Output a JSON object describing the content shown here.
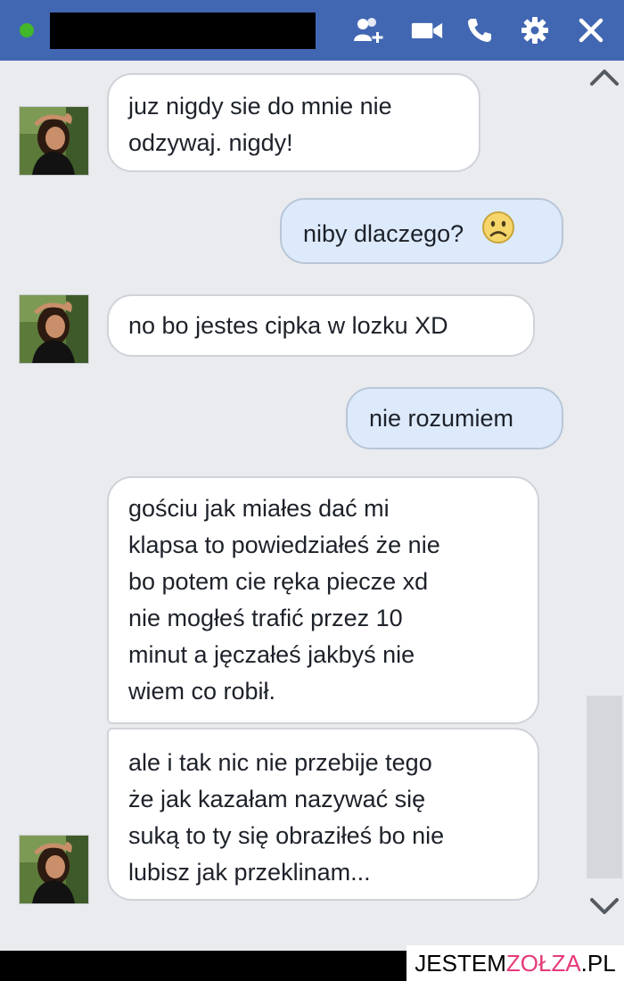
{
  "header": {
    "status": "online",
    "name_redacted": true,
    "icons": [
      "add-friend-icon",
      "video-call-icon",
      "phone-icon",
      "gear-icon",
      "close-icon"
    ]
  },
  "messages": [
    {
      "side": "in",
      "lines": [
        "juz nigdy sie do mnie nie",
        "odzywaj. nigdy!"
      ]
    },
    {
      "side": "out",
      "lines": [
        "niby dlaczego?"
      ],
      "emoji": "frown-emoji"
    },
    {
      "side": "in",
      "lines": [
        "no bo jestes cipka w lozku XD"
      ]
    },
    {
      "side": "out",
      "lines": [
        "nie rozumiem"
      ]
    },
    {
      "side": "in",
      "lines": [
        "gościu jak miałes dać mi",
        "klapsa to powiedziałeś że nie",
        "bo potem cie ręka piecze xd",
        "nie mogłeś trafić przez 10",
        "minut a jęczałeś jakbyś nie",
        "wiem co robił."
      ]
    },
    {
      "side": "in",
      "lines": [
        "ale i tak nic nie przebije tego",
        "że jak kazałam nazywać się",
        "suką to ty się obraziłeś bo nie",
        "lubisz jak przeklinam..."
      ]
    }
  ],
  "watermark": {
    "part1": "JESTEM",
    "part2": "ZOŁZA",
    "part3": ".PL"
  },
  "colors": {
    "header": "#4267b2",
    "online": "#42b72a",
    "outgoing": "#ddeafc",
    "incoming": "#ffffff"
  }
}
